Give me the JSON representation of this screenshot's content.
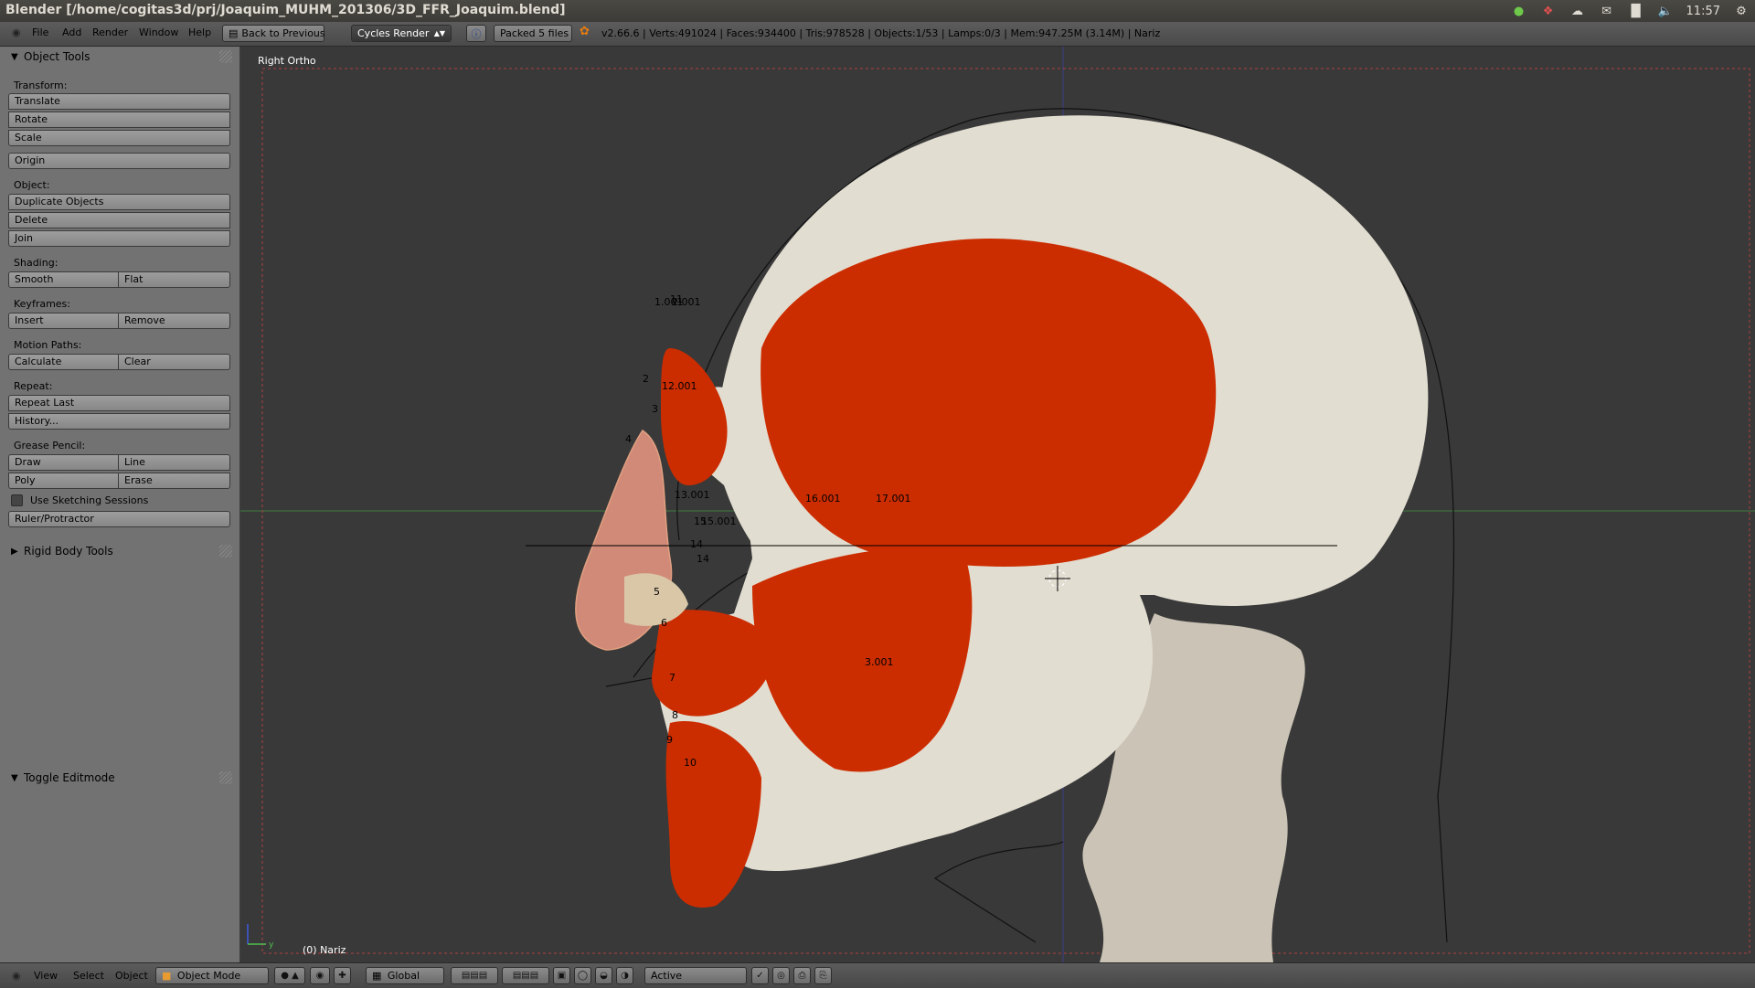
{
  "os": {
    "window_title": "Blender [/home/cogitas3d/prj/Joaquim_MUHM_201306/3D_FFR_Joaquim.blend]",
    "clock": "11:57"
  },
  "header": {
    "menus": [
      "File",
      "Add",
      "Render",
      "Window",
      "Help"
    ],
    "back_button": "Back to Previous",
    "render_engine": "Cycles Render",
    "packed": "Packed 5 files",
    "stats": "v2.66.6 | Verts:491024 | Faces:934400 | Tris:978528 | Objects:1/53 | Lamps:0/3 | Mem:947.25M (3.14M) | Nariz"
  },
  "toolshelf": {
    "object_tools": "Object Tools",
    "transform_label": "Transform:",
    "translate": "Translate",
    "rotate": "Rotate",
    "scale": "Scale",
    "origin": "Origin",
    "object_label": "Object:",
    "duplicate": "Duplicate Objects",
    "delete": "Delete",
    "join": "Join",
    "shading_label": "Shading:",
    "smooth": "Smooth",
    "flat": "Flat",
    "keyframes_label": "Keyframes:",
    "insert": "Insert",
    "remove": "Remove",
    "motion_label": "Motion Paths:",
    "calculate": "Calculate",
    "clear": "Clear",
    "repeat_label": "Repeat:",
    "repeat_last": "Repeat Last",
    "history": "History...",
    "grease_label": "Grease Pencil:",
    "draw": "Draw",
    "line": "Line",
    "poly": "Poly",
    "erase": "Erase",
    "sketching": "Use Sketching Sessions",
    "ruler": "Ruler/Protractor",
    "rigid_body": "Rigid Body Tools",
    "toggle_editmode": "Toggle Editmode"
  },
  "viewport": {
    "view_name": "Right Ortho",
    "object_name": "(0) Nariz",
    "axis_y": "y",
    "labels": [
      "1.001",
      "11",
      "2.001",
      "2",
      "12.001",
      "3",
      "4",
      "13.001",
      "15",
      "15.001",
      "14",
      "14",
      "16.001",
      "17.001",
      "5",
      "6",
      "7",
      "8",
      "9",
      "10",
      "3.001"
    ]
  },
  "footer": {
    "view": "View",
    "select": "Select",
    "object": "Object",
    "mode": "Object Mode",
    "orientation": "Global",
    "pivot": "Active"
  }
}
